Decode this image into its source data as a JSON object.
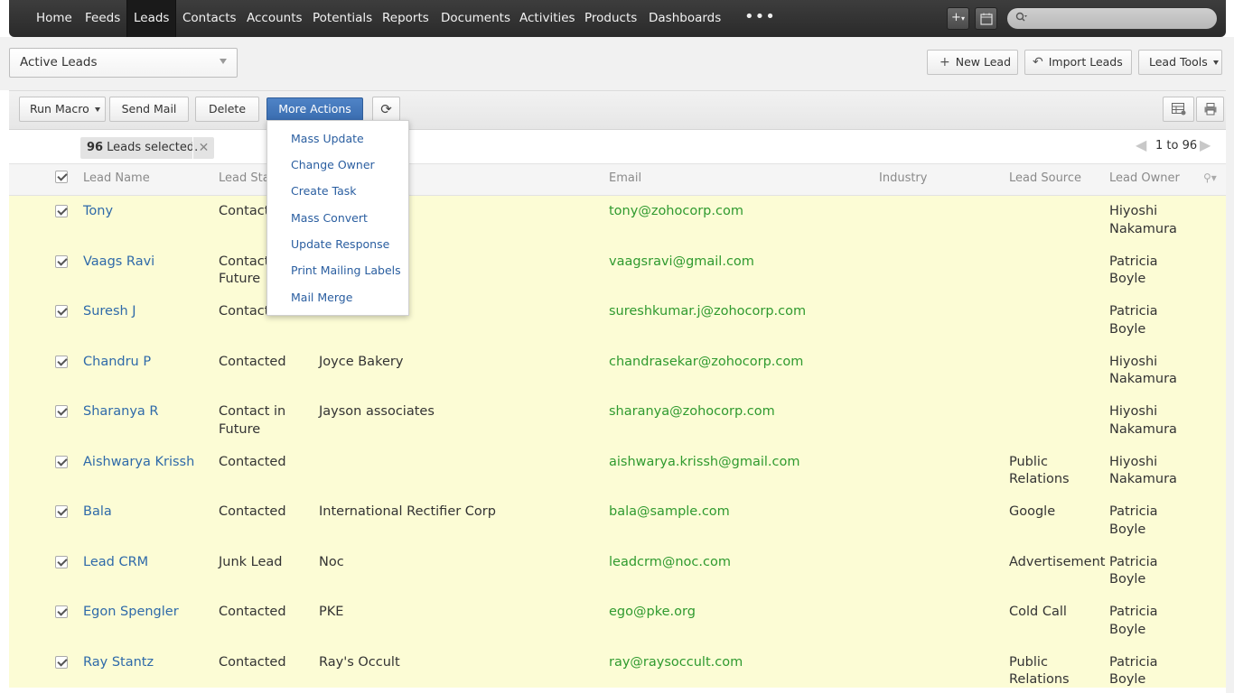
{
  "nav": {
    "items": [
      "Home",
      "Feeds",
      "Leads",
      "Contacts",
      "Accounts",
      "Potentials",
      "Reports",
      "Documents",
      "Activities",
      "Products",
      "Dashboards"
    ],
    "active": "Leads",
    "more": "•••"
  },
  "toolbar": {
    "view_select": "Active Leads",
    "new_lead": "New Lead",
    "import_leads": "Import Leads",
    "lead_tools": "Lead Tools",
    "run_macro": "Run Macro",
    "send_mail": "Send Mail",
    "delete": "Delete",
    "more_actions": "More Actions"
  },
  "selection": {
    "count": "96",
    "label": "Leads selected.",
    "pager": "1 to 96"
  },
  "columns": {
    "lead_name": "Lead Name",
    "lead_status": "Lead Sta",
    "email": "Email",
    "industry": "Industry",
    "lead_source": "Lead Source",
    "lead_owner": "Lead Owner"
  },
  "rows": [
    {
      "name": "Tony",
      "status": "Contacte",
      "status2": "",
      "company": "",
      "email": "tony@zohocorp.com",
      "source": "",
      "source2": "",
      "owner1": "Hiyoshi",
      "owner2": "Nakamura"
    },
    {
      "name": "Vaags Ravi",
      "status": "Contact",
      "status2": "Future",
      "company": "nces",
      "email": "vaagsravi@gmail.com",
      "source": "",
      "source2": "",
      "owner1": "Patricia",
      "owner2": "Boyle"
    },
    {
      "name": "Suresh J",
      "status": "Contacte",
      "status2": "",
      "company": "",
      "email": "sureshkumar.j@zohocorp.com",
      "source": "",
      "source2": "",
      "owner1": "Patricia",
      "owner2": "Boyle"
    },
    {
      "name": "Chandru P",
      "status": "Contacted",
      "status2": "",
      "company": "Joyce Bakery",
      "email": "chandrasekar@zohocorp.com",
      "source": "",
      "source2": "",
      "owner1": "Hiyoshi",
      "owner2": "Nakamura"
    },
    {
      "name": "Sharanya R",
      "status": "Contact in",
      "status2": "Future",
      "company": "Jayson associates",
      "email": "sharanya@zohocorp.com",
      "source": "",
      "source2": "",
      "owner1": "Hiyoshi",
      "owner2": "Nakamura"
    },
    {
      "name": "Aishwarya Krissh",
      "status": "Contacted",
      "status2": "",
      "company": "",
      "email": "aishwarya.krissh@gmail.com",
      "source": "Public",
      "source2": "Relations",
      "owner1": "Hiyoshi",
      "owner2": "Nakamura"
    },
    {
      "name": "Bala",
      "status": "Contacted",
      "status2": "",
      "company": "International Rectifier Corp",
      "email": "bala@sample.com",
      "source": "Google",
      "source2": "",
      "owner1": "Patricia",
      "owner2": "Boyle"
    },
    {
      "name": "Lead CRM",
      "status": "Junk Lead",
      "status2": "",
      "company": "Noc",
      "email": "leadcrm@noc.com",
      "source": "Advertisement",
      "source2": "",
      "owner1": "Patricia",
      "owner2": "Boyle"
    },
    {
      "name": "Egon Spengler",
      "status": "Contacted",
      "status2": "",
      "company": "PKE",
      "email": "ego@pke.org",
      "source": "Cold Call",
      "source2": "",
      "owner1": "Patricia",
      "owner2": "Boyle"
    },
    {
      "name": "Ray Stantz",
      "status": "Contacted",
      "status2": "",
      "company": "Ray's Occult",
      "email": "ray@raysoccult.com",
      "source": "Public",
      "source2": "Relations",
      "owner1": "Patricia",
      "owner2": "Boyle"
    }
  ],
  "menu": {
    "items": [
      "Mass Update",
      "Change Owner",
      "Create Task",
      "Mass Convert",
      "Update Response",
      "Print Mailing Labels",
      "Mail Merge"
    ]
  }
}
